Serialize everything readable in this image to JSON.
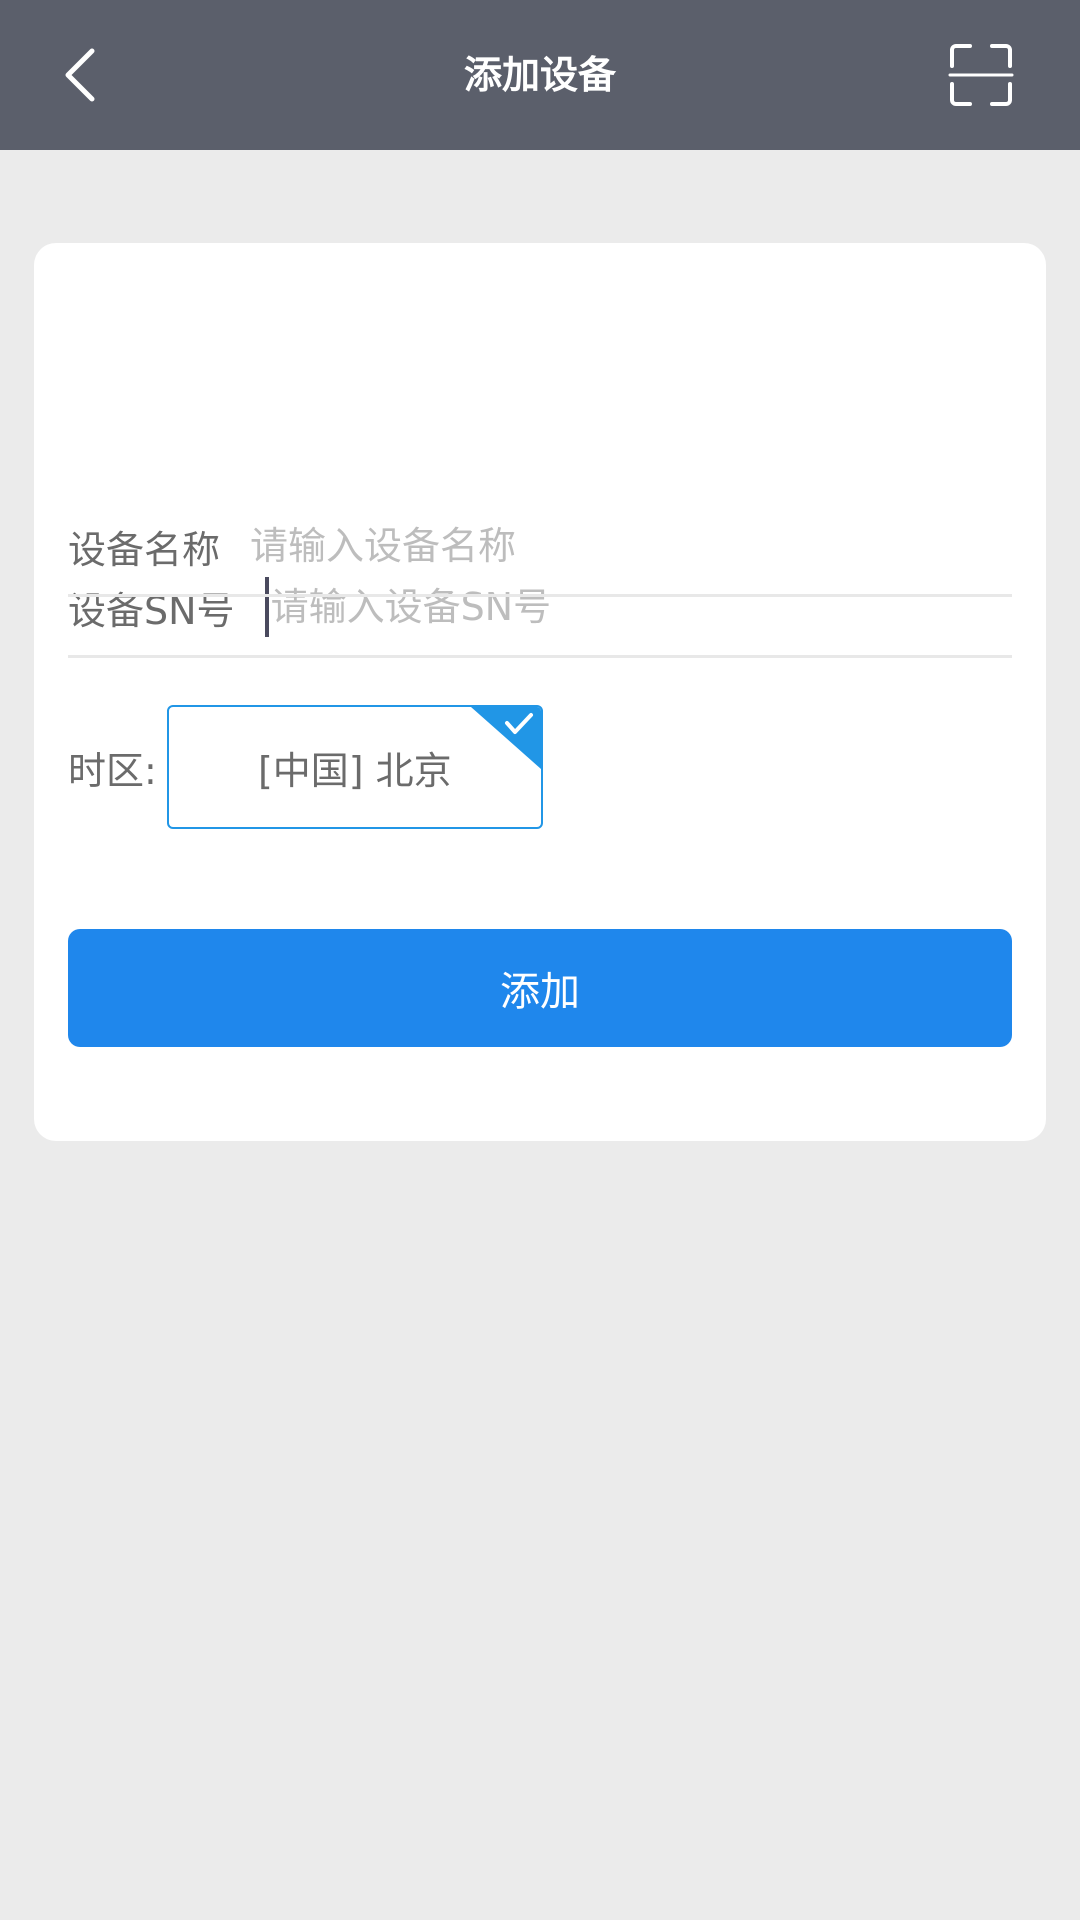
{
  "header": {
    "title": "添加设备",
    "back_icon": "chevron-left-icon",
    "scan_icon": "scan-icon",
    "background_color": "#5b5f6b"
  },
  "form": {
    "sn_label": "设备SN号",
    "sn_placeholder": "请输入设备SN号",
    "sn_value": "",
    "name_label": "设备名称",
    "name_placeholder": "请输入设备名称",
    "name_value": "",
    "timezone_label": "时区:",
    "timezone_value": "[中国] 北京",
    "timezone_selected_icon": "checkmark-icon"
  },
  "actions": {
    "add_label": "添加",
    "add_color": "#1f87ec"
  },
  "colors": {
    "page_background": "#ebebeb",
    "accent": "#2196e6"
  }
}
